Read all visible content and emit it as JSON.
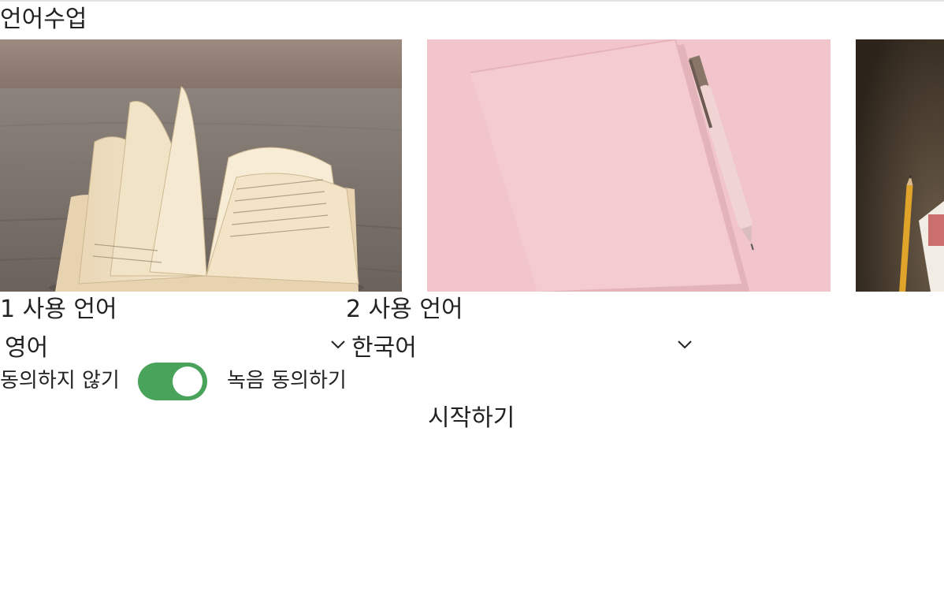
{
  "page": {
    "title": "언어수업"
  },
  "cards": [
    {
      "name": "open-book-photo",
      "alt": "open book"
    },
    {
      "name": "pink-notebook-photo",
      "alt": "pink notebook with pen"
    },
    {
      "name": "desk-pencil-photo",
      "alt": "pencil on desk"
    }
  ],
  "language1": {
    "label": "1 사용 언어",
    "selected": "영어",
    "icon": "chevron-down-icon"
  },
  "language2": {
    "label": "2 사용 언어",
    "selected": "한국어",
    "icon": "chevron-down-icon"
  },
  "consent": {
    "off_label": "동의하지 않기",
    "on_label": "녹음 동의하기",
    "enabled": true,
    "on_color": "#4aa35a"
  },
  "start_button": {
    "label": "시작하기"
  }
}
